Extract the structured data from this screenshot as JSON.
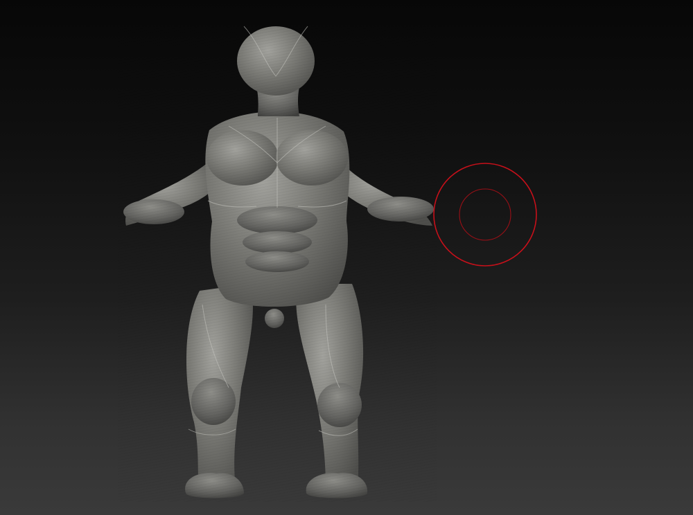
{
  "viewport": {
    "background_top": "#070707",
    "background_bottom": "#3a3a3a",
    "model_color": "#7a7a76",
    "model_shadow": "#4a4a47",
    "model_highlight": "#a8a8a2"
  },
  "brush_cursor": {
    "icon": "brush-ring-icon",
    "color": "#c8101a"
  }
}
